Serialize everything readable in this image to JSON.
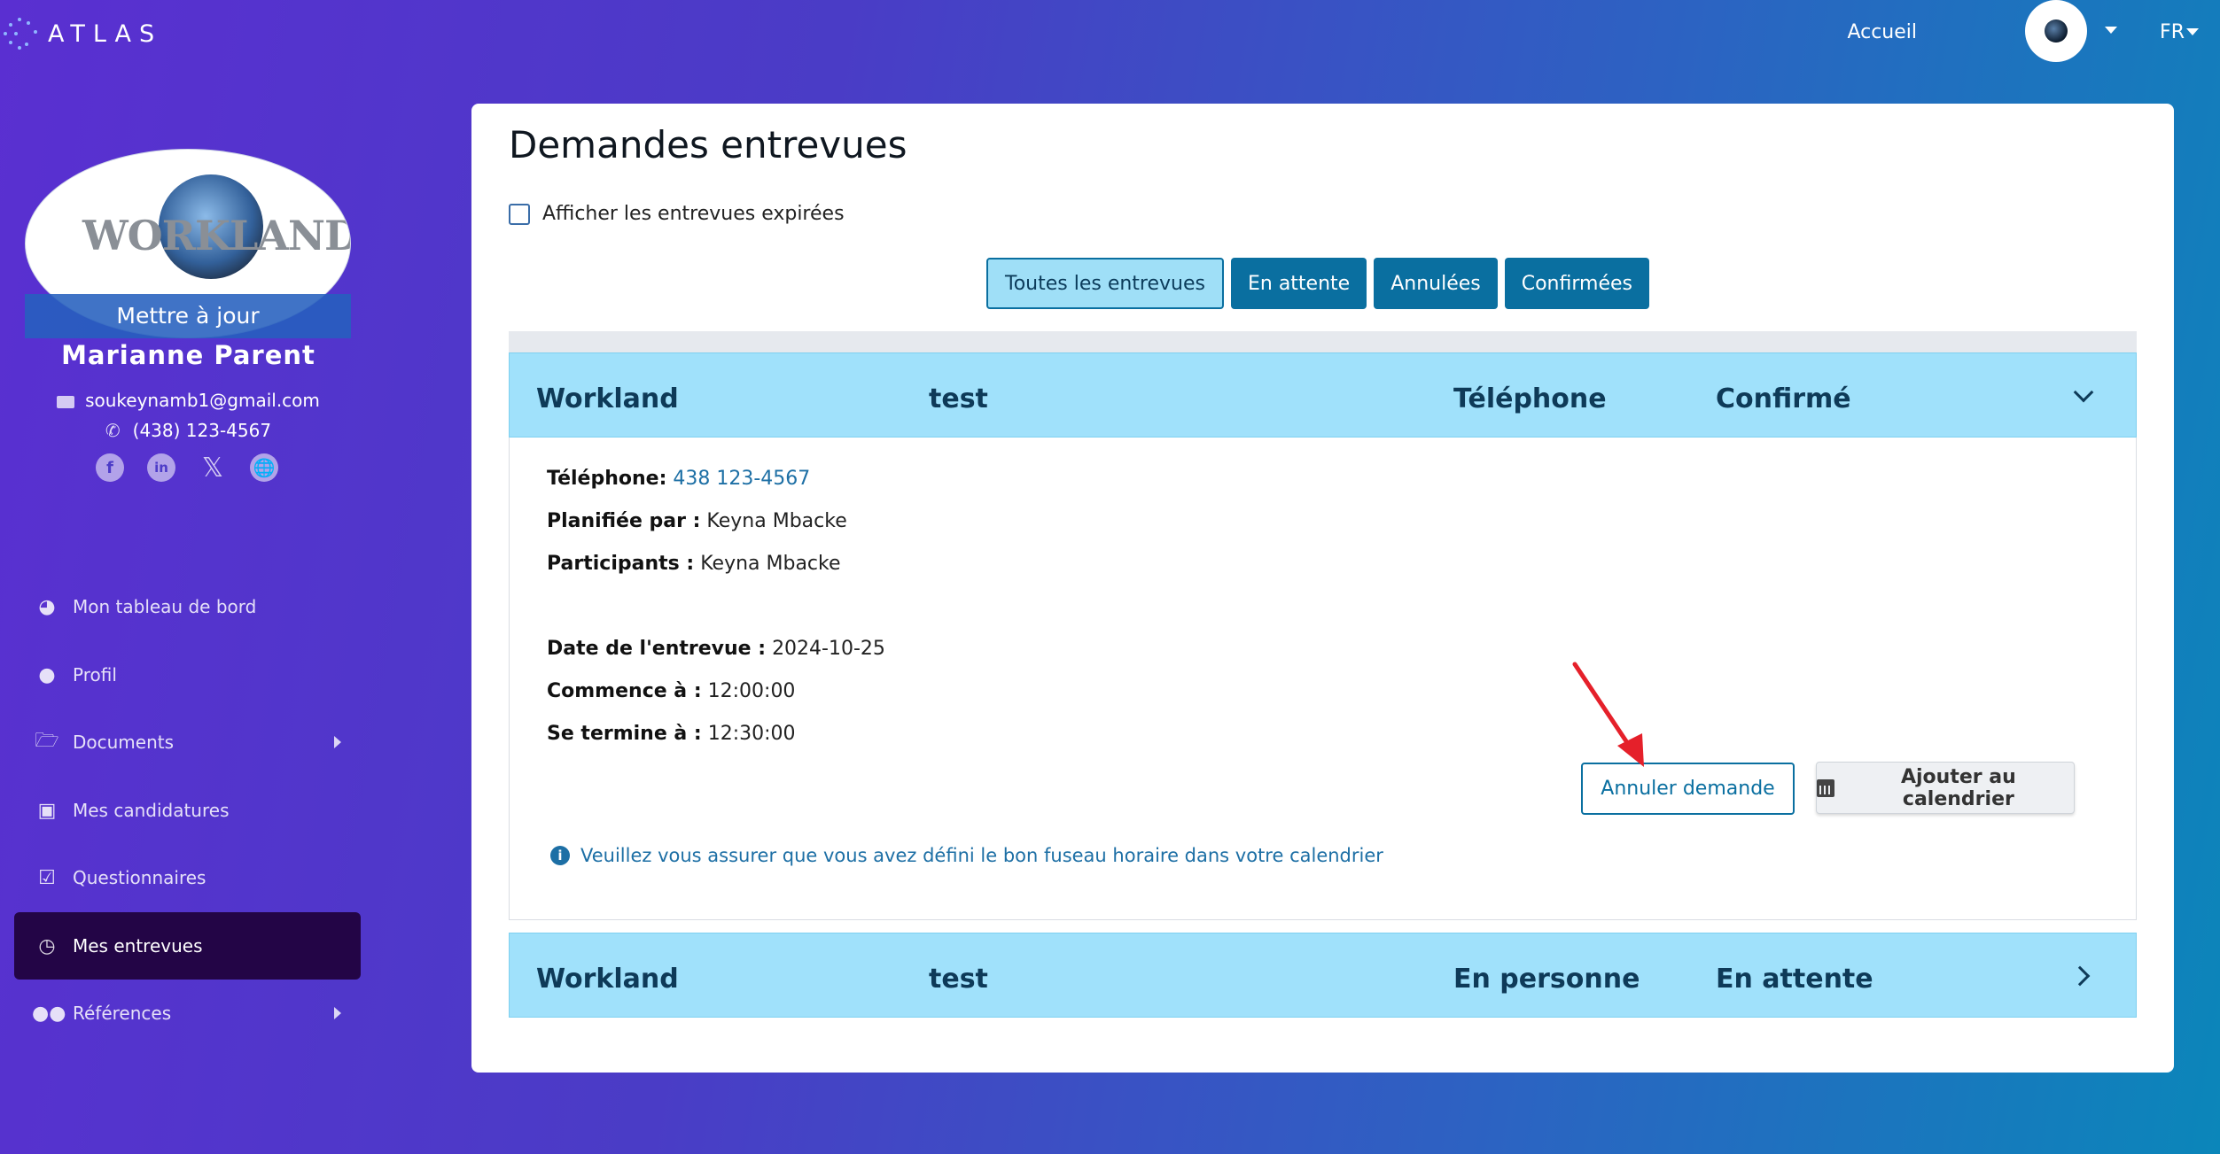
{
  "app": {
    "logo_text": "ATLAS",
    "nav_home": "Accueil",
    "lang": "FR"
  },
  "profile": {
    "logo_text": "WORKLAND",
    "update_label": "Mettre à jour",
    "name": "Marianne  Parent",
    "email": "soukeynamb1@gmail.com",
    "phone": "(438) 123-4567",
    "socials": [
      "facebook-icon",
      "linkedin-icon",
      "x-icon",
      "globe-icon"
    ]
  },
  "sidebar": {
    "items": [
      {
        "label": "Mon tableau de bord",
        "icon": "dashboard-icon"
      },
      {
        "label": "Profil",
        "icon": "user-icon"
      },
      {
        "label": "Documents",
        "icon": "folder-icon"
      },
      {
        "label": "Mes candidatures",
        "icon": "briefcase-icon"
      },
      {
        "label": "Questionnaires",
        "icon": "checkbox-icon"
      },
      {
        "label": "Mes entrevues",
        "icon": "clock-icon"
      },
      {
        "label": "Références",
        "icon": "users-icon"
      }
    ],
    "active": "Mes entrevues"
  },
  "main": {
    "title": "Demandes entrevues",
    "expired_label": "Afficher les entrevues expirées",
    "filters": [
      "Toutes les entrevues",
      "En attente",
      "Annulées",
      "Confirmées"
    ],
    "active_filter": "Toutes les entrevues",
    "interviews": [
      {
        "company": "Workland",
        "title": "test",
        "type": "Téléphone",
        "status": "Confirmé",
        "expanded": true,
        "details": {
          "phone_label": "Téléphone:",
          "phone": "438 123-4567",
          "planned_label": "Planifiée par :",
          "planned_by": "Keyna Mbacke",
          "participants_label": "Participants :",
          "participants": "Keyna Mbacke",
          "date_label": "Date de l'entrevue :",
          "date": "2024-10-25",
          "start_label": "Commence à :",
          "start": "12:00:00",
          "end_label": "Se termine à :",
          "end": "12:30:00",
          "cancel_label": "Annuler demande",
          "calendar_label": "Ajouter au calendrier",
          "timezone_note": "Veuillez vous assurer que vous avez défini le bon fuseau horaire dans votre calendrier"
        }
      },
      {
        "company": "Workland",
        "title": "test",
        "type": "En personne",
        "status": "En attente",
        "expanded": false
      }
    ]
  },
  "colors": {
    "primary": "#0a6fa0",
    "accordion_header": "#a0e1fb",
    "sidebar_active": "#230546",
    "annotation_arrow": "#e5202a"
  }
}
